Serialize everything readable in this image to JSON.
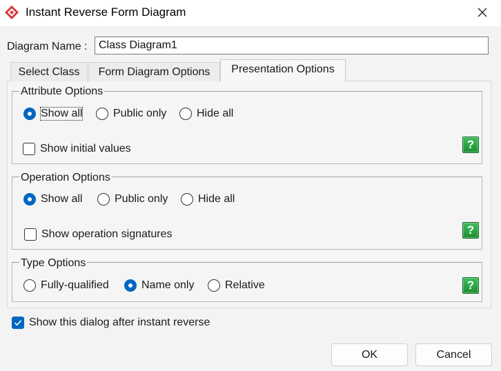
{
  "window": {
    "title": "Instant Reverse Form Diagram",
    "app_icon": "visual-paradigm-icon",
    "close_icon": "close-icon"
  },
  "diagram_name": {
    "label": "Diagram Name :",
    "value": "Class Diagram1"
  },
  "tabs": [
    {
      "label": "Select Class",
      "selected": false
    },
    {
      "label": "Form Diagram Options",
      "selected": false
    },
    {
      "label": "Presentation Options",
      "selected": true
    }
  ],
  "attribute_options": {
    "title": "Attribute Options",
    "radios": [
      {
        "label": "Show all",
        "selected": true
      },
      {
        "label": "Public only",
        "selected": false
      },
      {
        "label": "Hide all",
        "selected": false
      }
    ],
    "checkbox": {
      "label": "Show initial values",
      "checked": false
    },
    "help": "?"
  },
  "operation_options": {
    "title": "Operation Options",
    "radios": [
      {
        "label": "Show all",
        "selected": true
      },
      {
        "label": "Public only",
        "selected": false
      },
      {
        "label": "Hide all",
        "selected": false
      }
    ],
    "checkbox": {
      "label": "Show operation signatures",
      "checked": false
    },
    "help": "?"
  },
  "type_options": {
    "title": "Type Options",
    "radios": [
      {
        "label": "Fully-qualified",
        "selected": false
      },
      {
        "label": "Name only",
        "selected": true
      },
      {
        "label": "Relative",
        "selected": false
      }
    ],
    "help": "?"
  },
  "show_dialog": {
    "label": "Show this dialog after instant reverse",
    "checked": true
  },
  "buttons": {
    "ok": "OK",
    "cancel": "Cancel"
  },
  "colors": {
    "accent": "#0067c0",
    "help_green": "#1d8f33",
    "app_icon_red": "#d4373b"
  }
}
